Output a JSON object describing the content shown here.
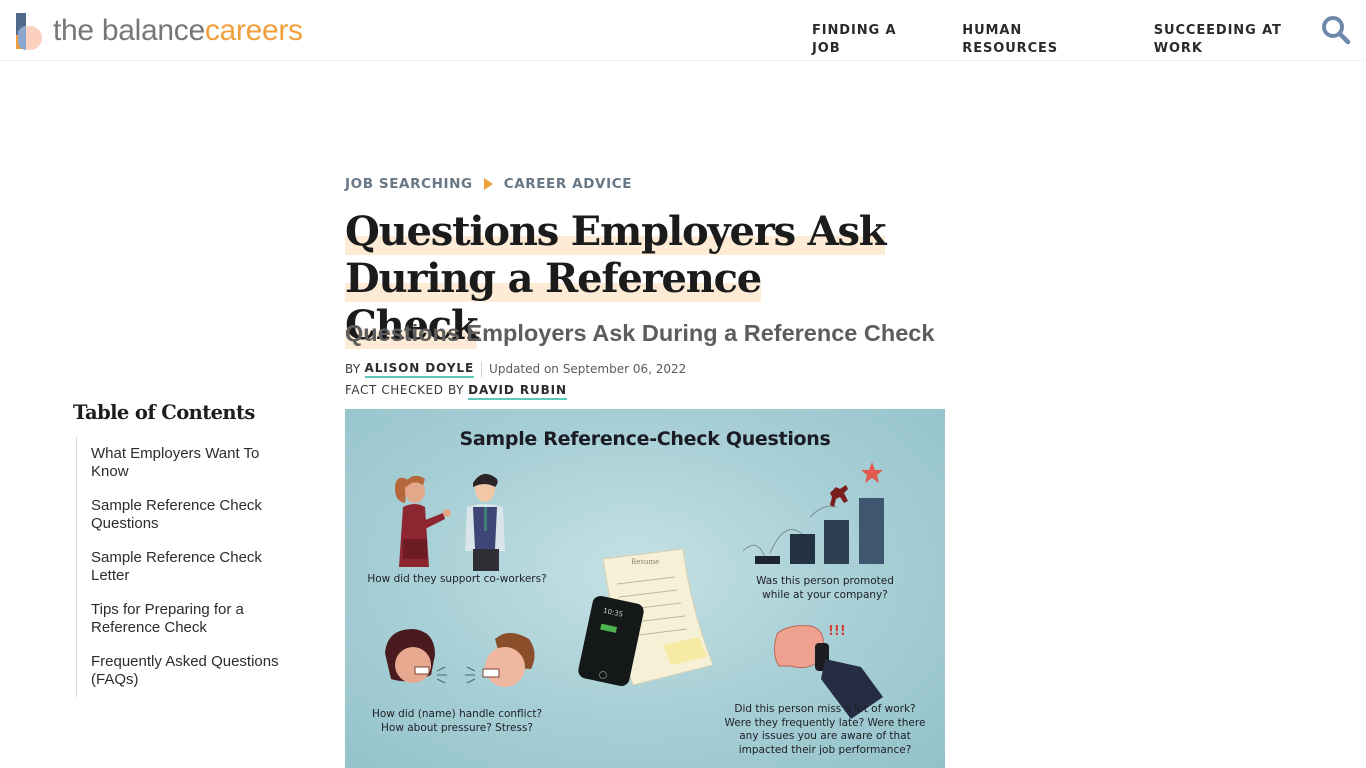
{
  "header": {
    "logo": {
      "word1": "the balance",
      "word2": "careers"
    },
    "nav": [
      {
        "label": "FINDING A JOB"
      },
      {
        "label": "HUMAN RESOURCES"
      },
      {
        "label": "SUCCEEDING AT WORK"
      }
    ],
    "search_icon": "search-icon"
  },
  "breadcrumb": [
    {
      "label": "JOB SEARCHING"
    },
    {
      "label": "CAREER ADVICE"
    }
  ],
  "article": {
    "title": "Questions Employers Ask During a Reference Check",
    "subtitle": "Questions Employers Ask During a Reference Check",
    "byline_prefix": "BY",
    "author": "ALISON DOYLE",
    "updated": "Updated on September 06, 2022",
    "factcheck_prefix": "FACT CHECKED BY",
    "fact_checker": "DAVID RUBIN"
  },
  "toc": {
    "title": "Table of Contents",
    "items": [
      {
        "label": "What Employers Want To Know"
      },
      {
        "label": "Sample Reference Check Questions"
      },
      {
        "label": "Sample Reference Check Letter"
      },
      {
        "label": "Tips for Preparing for a Reference Check"
      },
      {
        "label": "Frequently Asked Questions (FAQs)"
      }
    ]
  },
  "figure": {
    "title": "Sample Reference-Check Questions",
    "captions": {
      "coworkers": "How did they support co-workers?",
      "promoted_1": "Was this person promoted",
      "promoted_2": "while at your company?",
      "conflict_1": "How did (name) handle conflict?",
      "conflict_2": "How about pressure? Stress?",
      "attendance_1": "Did this person miss a lot of work?",
      "attendance_2": "Were they frequently late? Were there",
      "attendance_3": "any issues you are aware of that",
      "attendance_4": "impacted their job performance?"
    },
    "resume_label": "Resume",
    "phone_time": "10:35",
    "alert_marks": "!!!"
  },
  "colors": {
    "brand_orange": "#f29f3d",
    "brand_blue": "#51698a",
    "link_underline": "#5ac9bc",
    "title_highlight": "#fdebd6"
  }
}
